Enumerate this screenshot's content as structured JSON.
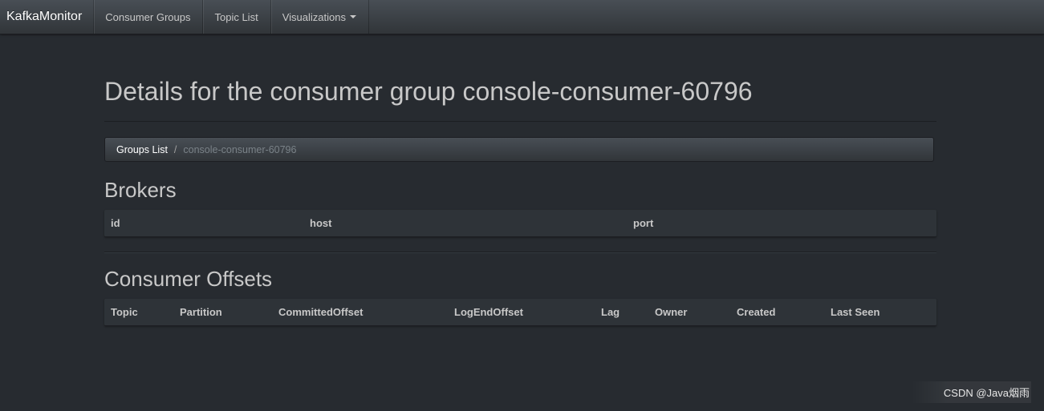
{
  "navbar": {
    "brand": "KafkaMonitor",
    "items": [
      {
        "label": "Consumer Groups"
      },
      {
        "label": "Topic List"
      },
      {
        "label": "Visualizations"
      }
    ]
  },
  "page": {
    "title": "Details for the consumer group console-consumer-60796"
  },
  "breadcrumb": {
    "link": "Groups List",
    "separator": "/",
    "active": "console-consumer-60796"
  },
  "brokers": {
    "title": "Brokers",
    "columns": [
      "id",
      "host",
      "port"
    ]
  },
  "offsets": {
    "title": "Consumer Offsets",
    "columns": [
      "Topic",
      "Partition",
      "CommittedOffset",
      "LogEndOffset",
      "Lag",
      "Owner",
      "Created",
      "Last Seen"
    ]
  },
  "watermark": "CSDN @Java烟雨"
}
